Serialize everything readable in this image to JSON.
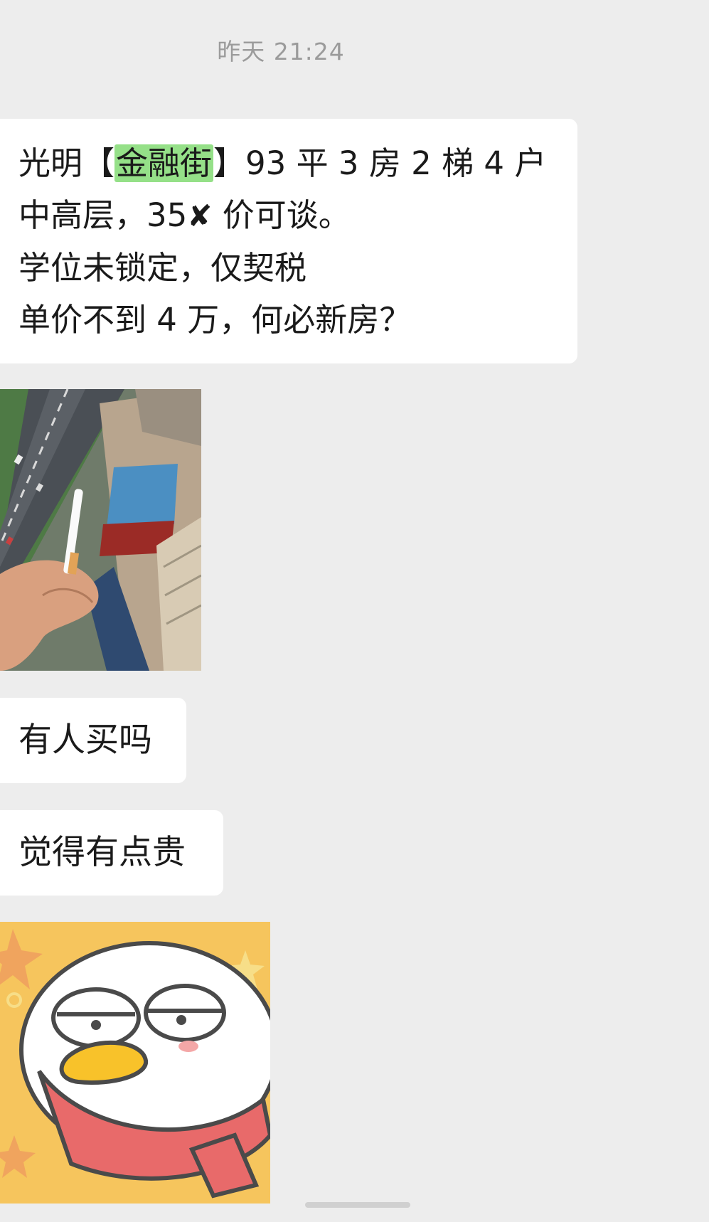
{
  "timestamp": "昨天 21:24",
  "messages": {
    "listing": {
      "line1_prefix": "光明【",
      "line1_highlight": "金融街",
      "line1_suffix": "】93 平 3 房 2 梯 4 户",
      "line2_prefix": " 中高层，35",
      "line2_mark": "✘",
      "line2_suffix": " 价可谈。",
      "line3": "学位未锁定，仅契税",
      "line4": "单价不到 4 万，何必新房？"
    },
    "question": "有人买吗",
    "comment": "觉得有点贵"
  },
  "images": {
    "photo_icon": "rooftop-cigarette-photo",
    "sticker_icon": "white-duck-scarf-sticker"
  },
  "colors": {
    "background": "#ededed",
    "bubble": "#ffffff",
    "highlight": "#95e088",
    "timestamp_text": "#9b9b9b"
  }
}
